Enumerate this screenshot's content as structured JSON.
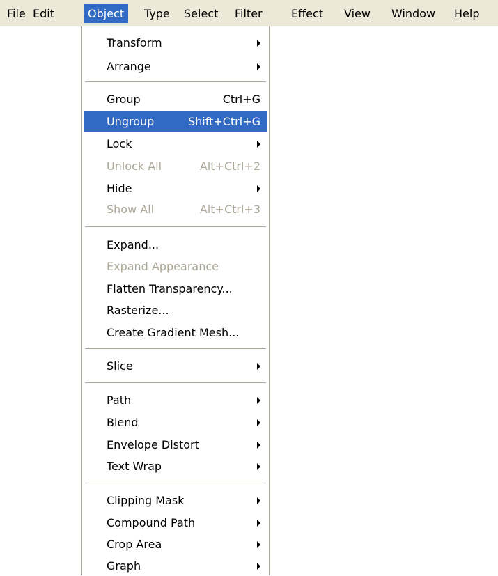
{
  "menubar": {
    "items": [
      "File",
      "Edit",
      "Object",
      "Type",
      "Select",
      "Filter",
      "Effect",
      "View",
      "Window",
      "Help"
    ],
    "open_item": "Object"
  },
  "colors": {
    "menubar_bg": "#ece9d8",
    "highlight": "#316ac5",
    "disabled_text": "#aca899",
    "separator": "#aca899"
  },
  "object_menu": {
    "transform": "Transform",
    "arrange": "Arrange",
    "group": "Group",
    "group_shortcut": "Ctrl+G",
    "ungroup": "Ungroup",
    "ungroup_shortcut": "Shift+Ctrl+G",
    "lock": "Lock",
    "unlock_all": "Unlock All",
    "unlock_all_shortcut": "Alt+Ctrl+2",
    "hide": "Hide",
    "show_all": "Show All",
    "show_all_shortcut": "Alt+Ctrl+3",
    "expand": "Expand...",
    "expand_appearance": "Expand Appearance",
    "flatten_transparency": "Flatten Transparency...",
    "rasterize": "Rasterize...",
    "create_gradient_mesh": "Create Gradient Mesh...",
    "slice": "Slice",
    "path": "Path",
    "blend": "Blend",
    "envelope_distort": "Envelope Distort",
    "text_wrap": "Text Wrap",
    "clipping_mask": "Clipping Mask",
    "compound_path": "Compound Path",
    "crop_area": "Crop Area",
    "graph": "Graph",
    "highlighted_item": "Ungroup",
    "disabled_items": [
      "Unlock All",
      "Show All",
      "Expand Appearance"
    ],
    "submenu_arrow_icon": "submenu-arrow-icon"
  }
}
